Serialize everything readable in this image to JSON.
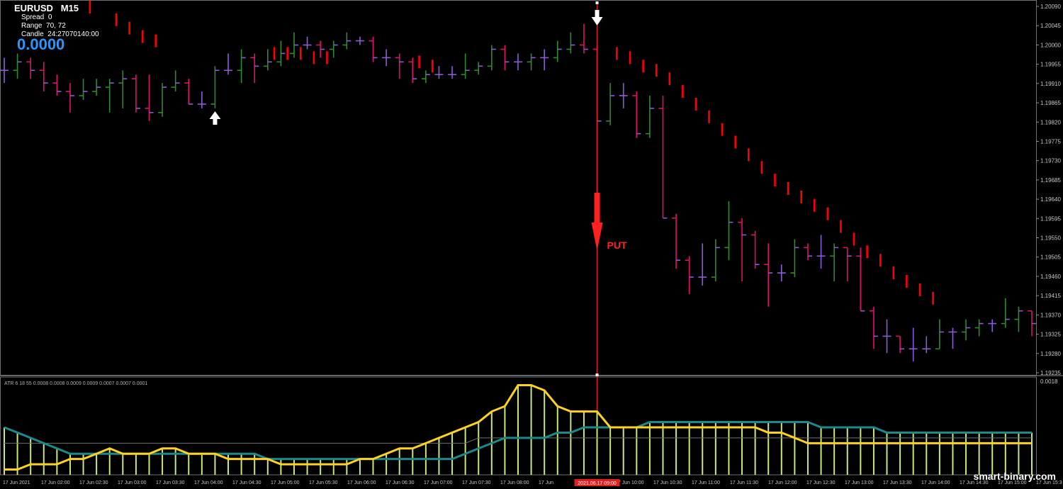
{
  "header": {
    "symbol": "EURUSD",
    "timeframe": "M15",
    "spread_label": "Spread",
    "spread_value": "0",
    "range_label": "Range",
    "range_value": "70, 72",
    "candle_label": "Candle",
    "candle_value": "24:27070140:00",
    "big_value": "0.0000"
  },
  "signals": {
    "put_label": "PUT",
    "up_arrow_icon": "up-arrow-icon",
    "down_arrow_icon": "down-arrow-icon"
  },
  "price_axis": [
    "1.20090",
    "1.20045",
    "1.20000",
    "1.19955",
    "1.19910",
    "1.19865",
    "1.19820",
    "1.19775",
    "1.19730",
    "1.19685",
    "1.19640",
    "1.19595",
    "1.19550",
    "1.19505",
    "1.19460",
    "1.19415",
    "1.19370",
    "1.19325",
    "1.19280",
    "1.19235"
  ],
  "indicator": {
    "label": "ATR 6 18 55 0.0008 0.0008 0.0009 0.0009 0.0007 0.0007 0.0001",
    "axis_top": "0.0018"
  },
  "time_axis": [
    "17 Jun 2021",
    "17 Jun 02:00",
    "17 Jun 02:30",
    "17 Jun 03:00",
    "17 Jun 03:30",
    "17 Jun 04:00",
    "17 Jun 04:30",
    "17 Jun 05:00",
    "17 Jun 05:30",
    "17 Jun 06:00",
    "17 Jun 06:30",
    "17 Jun 07:00",
    "17 Jun 07:30",
    "17 Jun 08:00",
    "17 Jun",
    "17 Jun 09:30",
    "17 Jun 10:00",
    "17 Jun 10:30",
    "17 Jun 11:00",
    "17 Jun 11:30",
    "17 Jun 12:00",
    "17 Jun 12:30",
    "17 Jun 13:00",
    "17 Jun 13:30",
    "17 Jun 14:00",
    "17 Jun 14:30",
    "17 Jun 15:00",
    "17 Jun 15:3"
  ],
  "time_cursor": "2021.06.17 09:00",
  "watermark": "smart-binary.com",
  "colors": {
    "background": "#000000",
    "bull": "#2e8b2e",
    "bear": "#e0106a",
    "neutral": "#8c5cd8",
    "dots": "#ff0000",
    "signal": "#ff2020",
    "atr_fast": "#ffd21e",
    "atr_slow": "#1b8a8a",
    "atr_bars": "#c9e87a"
  },
  "chart_data": {
    "type": "ohlc",
    "bars": [
      {
        "o": 1.1995,
        "h": 1.1998,
        "l": 1.1992,
        "c": 1.1995
      },
      {
        "o": 1.1995,
        "h": 1.1999,
        "l": 1.1993,
        "c": 1.1997
      },
      {
        "o": 1.1997,
        "h": 1.1998,
        "l": 1.1993,
        "c": 1.1995
      },
      {
        "o": 1.1995,
        "h": 1.1997,
        "l": 1.199,
        "c": 1.1992
      },
      {
        "o": 1.1992,
        "h": 1.1994,
        "l": 1.1989,
        "c": 1.199
      },
      {
        "o": 1.199,
        "h": 1.1992,
        "l": 1.1985,
        "c": 1.1989
      },
      {
        "o": 1.1989,
        "h": 1.1993,
        "l": 1.1988,
        "c": 1.199
      },
      {
        "o": 1.199,
        "h": 1.1993,
        "l": 1.1989,
        "c": 1.1991
      },
      {
        "o": 1.1991,
        "h": 1.1993,
        "l": 1.1985,
        "c": 1.1992
      },
      {
        "o": 1.1992,
        "h": 1.1995,
        "l": 1.1986,
        "c": 1.1993
      },
      {
        "o": 1.1993,
        "h": 1.1994,
        "l": 1.1985,
        "c": 1.1986
      },
      {
        "o": 1.1986,
        "h": 1.1994,
        "l": 1.1983,
        "c": 1.1985
      },
      {
        "o": 1.1985,
        "h": 1.1992,
        "l": 1.1984,
        "c": 1.1991
      },
      {
        "o": 1.1991,
        "h": 1.1995,
        "l": 1.199,
        "c": 1.1992
      },
      {
        "o": 1.1992,
        "h": 1.1993,
        "l": 1.1987,
        "c": 1.1987
      },
      {
        "o": 1.1987,
        "h": 1.199,
        "l": 1.1986,
        "c": 1.1987
      },
      {
        "o": 1.1987,
        "h": 1.1996,
        "l": 1.1986,
        "c": 1.1995
      },
      {
        "o": 1.1995,
        "h": 1.1999,
        "l": 1.1994,
        "c": 1.1995
      },
      {
        "o": 1.1995,
        "h": 1.2,
        "l": 1.1992,
        "c": 1.1998
      },
      {
        "o": 1.1998,
        "h": 1.1999,
        "l": 1.1992,
        "c": 1.1996
      },
      {
        "o": 1.1996,
        "h": 1.2,
        "l": 1.1995,
        "c": 1.1997
      },
      {
        "o": 1.1997,
        "h": 1.2002,
        "l": 1.1996,
        "c": 1.1999
      },
      {
        "o": 1.1999,
        "h": 1.2004,
        "l": 1.1998,
        "c": 1.2001
      },
      {
        "o": 1.2001,
        "h": 1.2003,
        "l": 1.2,
        "c": 1.2001
      },
      {
        "o": 1.2001,
        "h": 1.2002,
        "l": 1.1998,
        "c": 1.2
      },
      {
        "o": 1.2,
        "h": 1.2002,
        "l": 1.1998,
        "c": 1.2001
      },
      {
        "o": 1.2001,
        "h": 1.2004,
        "l": 1.2,
        "c": 1.2002
      },
      {
        "o": 1.2002,
        "h": 1.2003,
        "l": 1.2001,
        "c": 1.2002
      },
      {
        "o": 1.2002,
        "h": 1.2003,
        "l": 1.1997,
        "c": 1.1998
      },
      {
        "o": 1.1998,
        "h": 1.2,
        "l": 1.1996,
        "c": 1.1998
      },
      {
        "o": 1.1998,
        "h": 1.1999,
        "l": 1.1993,
        "c": 1.1997
      },
      {
        "o": 1.1997,
        "h": 1.1998,
        "l": 1.1992,
        "c": 1.1993
      },
      {
        "o": 1.1993,
        "h": 1.1995,
        "l": 1.1992,
        "c": 1.1994
      },
      {
        "o": 1.1994,
        "h": 1.1996,
        "l": 1.1993,
        "c": 1.1994
      },
      {
        "o": 1.1994,
        "h": 1.1996,
        "l": 1.1993,
        "c": 1.1994
      },
      {
        "o": 1.1994,
        "h": 1.1999,
        "l": 1.1993,
        "c": 1.1995
      },
      {
        "o": 1.1995,
        "h": 1.1997,
        "l": 1.1994,
        "c": 1.1996
      },
      {
        "o": 1.1996,
        "h": 1.2001,
        "l": 1.1995,
        "c": 1.2
      },
      {
        "o": 1.2,
        "h": 1.2001,
        "l": 1.1995,
        "c": 1.1997
      },
      {
        "o": 1.1997,
        "h": 1.1999,
        "l": 1.1995,
        "c": 1.1997
      },
      {
        "o": 1.1997,
        "h": 1.1999,
        "l": 1.1995,
        "c": 1.1998
      },
      {
        "o": 1.1998,
        "h": 1.2,
        "l": 1.1995,
        "c": 1.1998
      },
      {
        "o": 1.1998,
        "h": 1.2002,
        "l": 1.1997,
        "c": 1.2
      },
      {
        "o": 1.2,
        "h": 1.2004,
        "l": 1.1999,
        "c": 1.2001
      },
      {
        "o": 1.2001,
        "h": 1.2006,
        "l": 1.1999,
        "c": 1.2
      },
      {
        "o": 1.2,
        "h": 1.2001,
        "l": 1.1955,
        "c": 1.1983
      },
      {
        "o": 1.1983,
        "h": 1.1992,
        "l": 1.1982,
        "c": 1.1989
      },
      {
        "o": 1.1989,
        "h": 1.1992,
        "l": 1.1986,
        "c": 1.1989
      },
      {
        "o": 1.1989,
        "h": 1.199,
        "l": 1.1979,
        "c": 1.198
      },
      {
        "o": 1.198,
        "h": 1.1989,
        "l": 1.1979,
        "c": 1.1986
      },
      {
        "o": 1.1986,
        "h": 1.1989,
        "l": 1.196,
        "c": 1.196
      },
      {
        "o": 1.196,
        "h": 1.1961,
        "l": 1.1948,
        "c": 1.195
      },
      {
        "o": 1.195,
        "h": 1.1951,
        "l": 1.1942,
        "c": 1.1946
      },
      {
        "o": 1.1946,
        "h": 1.1954,
        "l": 1.1944,
        "c": 1.1946
      },
      {
        "o": 1.1946,
        "h": 1.1955,
        "l": 1.1945,
        "c": 1.1953
      },
      {
        "o": 1.1953,
        "h": 1.1964,
        "l": 1.195,
        "c": 1.1959
      },
      {
        "o": 1.1959,
        "h": 1.196,
        "l": 1.1945,
        "c": 1.1956
      },
      {
        "o": 1.1956,
        "h": 1.1957,
        "l": 1.1948,
        "c": 1.1949
      },
      {
        "o": 1.1949,
        "h": 1.1954,
        "l": 1.1939,
        "c": 1.1947
      },
      {
        "o": 1.1947,
        "h": 1.1949,
        "l": 1.1945,
        "c": 1.1947
      },
      {
        "o": 1.1947,
        "h": 1.1955,
        "l": 1.1946,
        "c": 1.1953
      },
      {
        "o": 1.1953,
        "h": 1.1954,
        "l": 1.195,
        "c": 1.1951
      },
      {
        "o": 1.1951,
        "h": 1.1956,
        "l": 1.1948,
        "c": 1.1951
      },
      {
        "o": 1.1951,
        "h": 1.1954,
        "l": 1.1945,
        "c": 1.1953
      },
      {
        "o": 1.1953,
        "h": 1.1953,
        "l": 1.1945,
        "c": 1.1951
      },
      {
        "o": 1.1951,
        "h": 1.1953,
        "l": 1.1938,
        "c": 1.1938
      },
      {
        "o": 1.1938,
        "h": 1.1939,
        "l": 1.1929,
        "c": 1.1932
      },
      {
        "o": 1.1932,
        "h": 1.1936,
        "l": 1.1928,
        "c": 1.1932
      },
      {
        "o": 1.1932,
        "h": 1.1932,
        "l": 1.1928,
        "c": 1.1929
      },
      {
        "o": 1.1929,
        "h": 1.1934,
        "l": 1.1926,
        "c": 1.1929
      },
      {
        "o": 1.1929,
        "h": 1.1932,
        "l": 1.1928,
        "c": 1.1929
      },
      {
        "o": 1.1929,
        "h": 1.1936,
        "l": 1.1929,
        "c": 1.1933
      },
      {
        "o": 1.1933,
        "h": 1.1934,
        "l": 1.1929,
        "c": 1.1933
      },
      {
        "o": 1.1933,
        "h": 1.1936,
        "l": 1.1931,
        "c": 1.1934
      },
      {
        "o": 1.1934,
        "h": 1.1936,
        "l": 1.1932,
        "c": 1.1935
      },
      {
        "o": 1.1935,
        "h": 1.1936,
        "l": 1.1933,
        "c": 1.1935
      },
      {
        "o": 1.1935,
        "h": 1.1941,
        "l": 1.1934,
        "c": 1.1936
      },
      {
        "o": 1.1936,
        "h": 1.1939,
        "l": 1.1933,
        "c": 1.1938
      },
      {
        "o": 1.1938,
        "h": 1.1938,
        "l": 1.1932,
        "c": 1.1935
      }
    ],
    "dots": [
      {
        "i": 6,
        "v": 1.201
      },
      {
        "i": 8,
        "v": 1.2007
      },
      {
        "i": 9,
        "v": 1.2005
      },
      {
        "i": 10,
        "v": 1.2003
      },
      {
        "i": 11,
        "v": 1.2002
      },
      {
        "i": 20,
        "v": 1.1999
      },
      {
        "i": 21,
        "v": 1.1999
      },
      {
        "i": 22,
        "v": 1.1999
      },
      {
        "i": 23,
        "v": 1.1998
      },
      {
        "i": 24,
        "v": 1.1998
      },
      {
        "i": 31,
        "v": 1.1997
      },
      {
        "i": 32,
        "v": 1.1996
      },
      {
        "i": 46,
        "v": 1.1999
      },
      {
        "i": 47,
        "v": 1.1998
      },
      {
        "i": 48,
        "v": 1.1996
      },
      {
        "i": 49,
        "v": 1.1995
      },
      {
        "i": 50,
        "v": 1.1993
      },
      {
        "i": 51,
        "v": 1.199
      },
      {
        "i": 52,
        "v": 1.1987
      },
      {
        "i": 53,
        "v": 1.1984
      },
      {
        "i": 54,
        "v": 1.1981
      },
      {
        "i": 55,
        "v": 1.1978
      },
      {
        "i": 56,
        "v": 1.1975
      },
      {
        "i": 57,
        "v": 1.1972
      },
      {
        "i": 58,
        "v": 1.1969
      },
      {
        "i": 59,
        "v": 1.1967
      },
      {
        "i": 60,
        "v": 1.1965
      },
      {
        "i": 61,
        "v": 1.1963
      },
      {
        "i": 62,
        "v": 1.1961
      },
      {
        "i": 63,
        "v": 1.1958
      },
      {
        "i": 64,
        "v": 1.1955
      },
      {
        "i": 65,
        "v": 1.1952
      },
      {
        "i": 66,
        "v": 1.195
      },
      {
        "i": 67,
        "v": 1.1947
      },
      {
        "i": 68,
        "v": 1.1945
      },
      {
        "i": 69,
        "v": 1.1943
      },
      {
        "i": 70,
        "v": 1.1941
      }
    ],
    "signal_bar_index": 45,
    "atr_fast": [
      0.0001,
      0.0001,
      0.0002,
      0.0002,
      0.0002,
      0.0003,
      0.0003,
      0.0004,
      0.0005,
      0.0004,
      0.0004,
      0.0004,
      0.0005,
      0.0005,
      0.0004,
      0.0004,
      0.0004,
      0.0003,
      0.0003,
      0.0003,
      0.0003,
      0.0002,
      0.0002,
      0.0002,
      0.0002,
      0.0002,
      0.0002,
      0.0003,
      0.0003,
      0.0004,
      0.0005,
      0.0005,
      0.0006,
      0.0007,
      0.0008,
      0.0009,
      0.001,
      0.0012,
      0.0013,
      0.0017,
      0.0017,
      0.0016,
      0.0013,
      0.0012,
      0.0012,
      0.0012,
      0.0009,
      0.0009,
      0.0009,
      0.0009,
      0.0009,
      0.0009,
      0.0009,
      0.0009,
      0.0009,
      0.0009,
      0.0009,
      0.0009,
      0.0008,
      0.0008,
      0.0007,
      0.0006,
      0.0006,
      0.0006,
      0.0006,
      0.0006,
      0.0006,
      0.0006,
      0.0006,
      0.0006,
      0.0006,
      0.0006,
      0.0006,
      0.0006,
      0.0006,
      0.0006,
      0.0006,
      0.0006,
      0.0006
    ],
    "atr_slow": [
      0.0009,
      0.0008,
      0.0007,
      0.0006,
      0.0005,
      0.0004,
      0.0004,
      0.0004,
      0.0004,
      0.0004,
      0.0004,
      0.0004,
      0.0004,
      0.0004,
      0.0004,
      0.0004,
      0.0004,
      0.0004,
      0.0004,
      0.0004,
      0.0003,
      0.0003,
      0.0003,
      0.0003,
      0.0003,
      0.0003,
      0.0003,
      0.0003,
      0.0003,
      0.0003,
      0.0003,
      0.0003,
      0.0003,
      0.0003,
      0.0003,
      0.0004,
      0.0005,
      0.0006,
      0.0007,
      0.0007,
      0.0007,
      0.0007,
      0.0008,
      0.0008,
      0.0009,
      0.0009,
      0.0009,
      0.0009,
      0.0009,
      0.001,
      0.001,
      0.001,
      0.001,
      0.001,
      0.001,
      0.001,
      0.001,
      0.001,
      0.001,
      0.001,
      0.001,
      0.001,
      0.0009,
      0.0009,
      0.0009,
      0.0009,
      0.0009,
      0.0008,
      0.0008,
      0.0008,
      0.0008,
      0.0008,
      0.0008,
      0.0008,
      0.0008,
      0.0008,
      0.0008,
      0.0008,
      0.0008
    ],
    "atr_base": [
      0.0006,
      0.0006,
      0.0006,
      0.0006,
      0.0006,
      0.0006,
      0.0006,
      0.0006,
      0.0006,
      0.0006,
      0.0006,
      0.0006,
      0.0006,
      0.0006,
      0.0006,
      0.0006,
      0.0006,
      0.0006,
      0.0006,
      0.0006,
      0.0006,
      0.0006,
      0.0006,
      0.0006,
      0.0006,
      0.0006,
      0.0006,
      0.0006,
      0.0006,
      0.0006,
      0.0006,
      0.0006,
      0.0006,
      0.0006,
      0.0006,
      0.0006,
      0.0007,
      0.0007,
      0.0007,
      0.0007,
      0.0007,
      0.0007,
      0.0007,
      0.0007,
      0.0007,
      0.0007,
      0.0007,
      0.0007,
      0.0007,
      0.0007,
      0.0007,
      0.0007,
      0.0007,
      0.0007,
      0.0007,
      0.0007,
      0.0007,
      0.0007,
      0.0007,
      0.0007,
      0.0007,
      0.0007,
      0.0007,
      0.0007,
      0.0007,
      0.0007,
      0.0007,
      0.0007,
      0.0007,
      0.0007,
      0.0007,
      0.0007,
      0.0007,
      0.0007,
      0.0007,
      0.0007,
      0.0007,
      0.0007,
      0.0007
    ],
    "price_min": 1.1923,
    "price_max": 1.2011,
    "atr_min": 0,
    "atr_max": 0.0018
  }
}
